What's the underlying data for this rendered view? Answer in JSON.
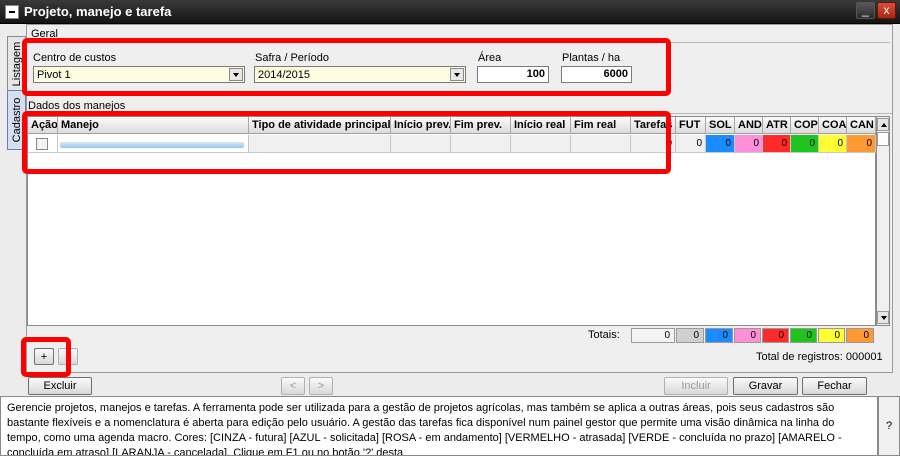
{
  "window": {
    "title": "Projeto, manejo e tarefa",
    "minimize": "_",
    "close": "x"
  },
  "side_tabs": {
    "listagem": "Listagem",
    "cadastro": "Cadastro"
  },
  "geral": {
    "section_label": "Geral",
    "centro_label": "Centro de custos",
    "centro_value": "Pivot 1",
    "safra_label": "Safra / Período",
    "safra_value": "2014/2015",
    "area_label": "Área",
    "area_value": "100",
    "plantas_label": "Plantas / ha",
    "plantas_value": "6000"
  },
  "manejos": {
    "section_label": "Dados dos manejos",
    "columns": [
      "Ação",
      "Manejo",
      "Tipo de atividade principal",
      "Início prev.",
      "Fim prev.",
      "Início real",
      "Fim real",
      "Tarefas",
      "FUT",
      "SOL",
      "AND",
      "ATR",
      "COP",
      "COA",
      "CAN"
    ],
    "row_values": [
      "0",
      "0",
      "0",
      "0",
      "0",
      "0",
      "0",
      "0"
    ],
    "totals_label": "Totais:",
    "totals": [
      "0",
      "0",
      "0",
      "0",
      "0",
      "0",
      "0",
      "0"
    ],
    "status_colors": {
      "tarefas": "#f0f0f0",
      "fut": "#c8c8c8",
      "sol": "#1a8cff",
      "and": "#ff8fd8",
      "atr": "#ff2a2a",
      "cop": "#1fc41f",
      "coa": "#ffff33",
      "can": "#ff9933"
    }
  },
  "grid_buttons": {
    "add": "+"
  },
  "record_count": "Total de registros: 000001",
  "actions": {
    "excluir": "Excluir",
    "prev": "<",
    "next": ">",
    "incluir": "Incluir",
    "gravar": "Gravar",
    "fechar": "Fechar"
  },
  "help": {
    "text": "Gerencie projetos, manejos e tarefas. A ferramenta pode ser utilizada para a gestão de projetos agrícolas, mas também se aplica a outras áreas, pois seus cadastros são bastante flexíveis e a nomenclatura é aberta para edição pelo usuário. A gestão das tarefas fica disponível num painel gestor que permite uma visão dinâmica na linha do tempo, como uma agenda macro. Cores: [CINZA - futura] [AZUL - solicitada] [ROSA - em andamento] [VERMELHO - atrasada] [VERDE - concluída no prazo] [AMARELO - concluída em atraso] [LARANJA - cancelada]. Clique em F1 ou no botão '?' desta",
    "button": "?"
  }
}
